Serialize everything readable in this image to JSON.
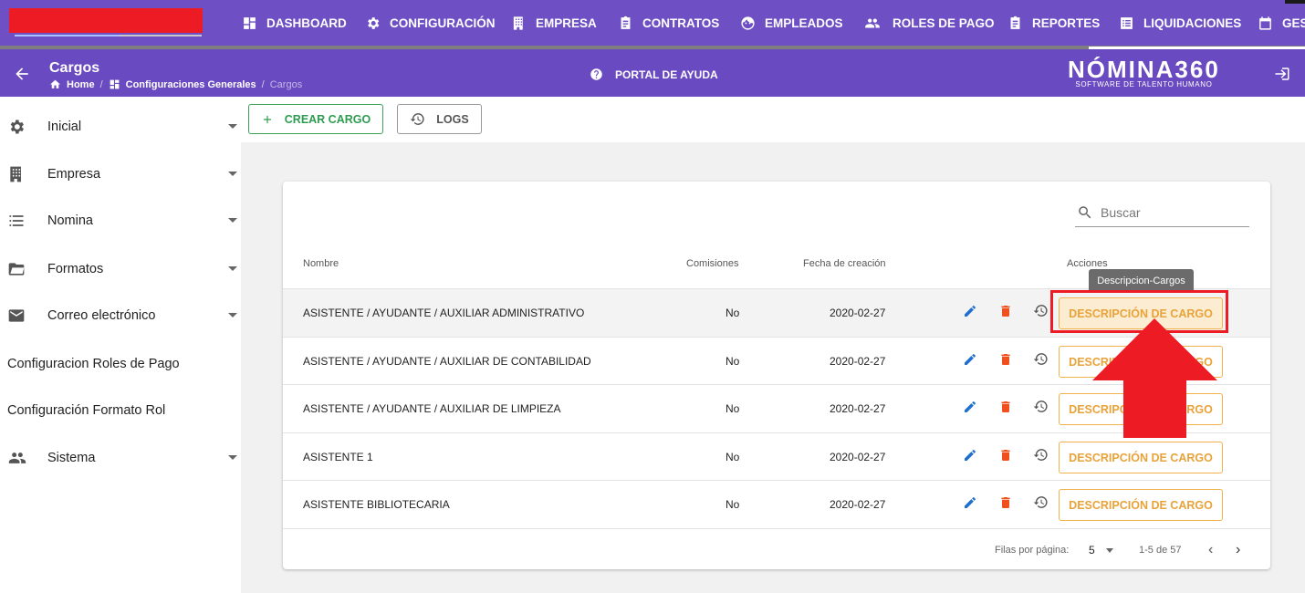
{
  "nav": {
    "items": [
      {
        "label": "DASHBOARD",
        "icon": "dashboard-icon"
      },
      {
        "label": "CONFIGURACIÓN",
        "icon": "gear-icon"
      },
      {
        "label": "EMPRESA",
        "icon": "building-icon"
      },
      {
        "label": "CONTRATOS",
        "icon": "clipboard-icon"
      },
      {
        "label": "EMPLEADOS",
        "icon": "face-icon"
      },
      {
        "label": "ROLES DE PAGO",
        "icon": "people-icon"
      },
      {
        "label": "REPORTES",
        "icon": "clipboard-icon"
      },
      {
        "label": "LIQUIDACIONES",
        "icon": "list-box-icon"
      },
      {
        "label": "GES",
        "icon": "calendar-icon"
      }
    ],
    "active": "LIQUIDACIONES"
  },
  "header": {
    "title": "Cargos",
    "breadcrumb": [
      "Home",
      "Configuraciones Generales",
      "Cargos"
    ],
    "breadcrumb_sep": "/",
    "help": "PORTAL DE AYUDA",
    "brand_big": "NÓMINA360",
    "brand_small": "SOFTWARE DE TALENTO HUMANO"
  },
  "sidebar": {
    "items": [
      {
        "label": "Inicial",
        "icon": "gear-icon",
        "expandable": true
      },
      {
        "label": "Empresa",
        "icon": "building-icon",
        "expandable": true
      },
      {
        "label": "Nomina",
        "icon": "list-icon",
        "expandable": true
      },
      {
        "label": "Formatos",
        "icon": "folder-icon",
        "expandable": true
      },
      {
        "label": "Correo electrónico",
        "icon": "mail-icon",
        "expandable": true
      },
      {
        "label": "Configuracion Roles de Pago",
        "expandable": false
      },
      {
        "label": "Configuración Formato Rol",
        "expandable": false
      },
      {
        "label": "Sistema",
        "icon": "people-icon",
        "expandable": true
      }
    ]
  },
  "toolbar": {
    "create_label": "CREAR CARGO",
    "logs_label": "LOGS"
  },
  "table": {
    "search_placeholder": "Buscar",
    "headers": {
      "name": "Nombre",
      "commissions": "Comisiones",
      "created": "Fecha de creación",
      "actions": "Acciones"
    },
    "rows": [
      {
        "name": "ASISTENTE / AYUDANTE / AUXILIAR ADMINISTRATIVO",
        "commissions": "No",
        "created": "2020-02-27",
        "action_label": "DESCRIPCIÓN DE CARGO"
      },
      {
        "name": "ASISTENTE / AYUDANTE / AUXILIAR DE CONTABILIDAD",
        "commissions": "No",
        "created": "2020-02-27",
        "action_label": "DESCRIPCIÓN DE CARGO"
      },
      {
        "name": "ASISTENTE / AYUDANTE / AUXILIAR DE LIMPIEZA",
        "commissions": "No",
        "created": "2020-02-27",
        "action_label": "DESCRIPCIÓN DE CARGO"
      },
      {
        "name": "ASISTENTE 1",
        "commissions": "No",
        "created": "2020-02-27",
        "action_label": "DESCRIPCIÓN DE CARGO"
      },
      {
        "name": "ASISTENTE BIBLIOTECARIA",
        "commissions": "No",
        "created": "2020-02-27",
        "action_label": "DESCRIPCIÓN DE CARGO"
      }
    ],
    "footer": {
      "rows_per_page_label": "Filas por página:",
      "rows_per_page": "5",
      "range": "1-5 de 57"
    }
  },
  "tooltip": "Descripcion-Cargos",
  "colors": {
    "nav_bg": "#6e4fc4",
    "create_green": "#2e9c50",
    "desc_orange": "#e8a33a",
    "annotation_red": "#ed1c24",
    "edit_blue": "#1e6fd0",
    "delete_red": "#f0501e"
  }
}
